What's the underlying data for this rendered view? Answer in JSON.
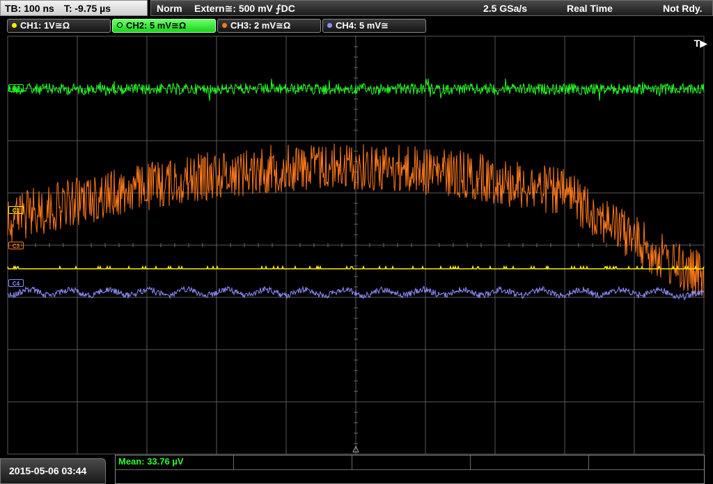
{
  "timebase": {
    "tb": "TB: 100 ns",
    "t": "T: -9.75 µs"
  },
  "trigger": {
    "mode": "Norm",
    "source": "Extern≅: 500 mV ⨍DC",
    "sample_rate": "2.5 GSa/s",
    "acq_mode": "Real Time",
    "status": "Not Rdy."
  },
  "channels": [
    {
      "id": "ch1",
      "label": "CH1: 1V≅Ω",
      "color": "#ffee00",
      "active": false
    },
    {
      "id": "ch2",
      "label": "CH2: 5 mV≅Ω",
      "color": "#22ff22",
      "active": true
    },
    {
      "id": "ch3",
      "label": "CH3: 2 mV≅Ω",
      "color": "#ff7a1a",
      "active": false
    },
    {
      "id": "ch4",
      "label": "CH4: 5 mV≅",
      "color": "#8f8fff",
      "active": false
    }
  ],
  "trace_markers": [
    {
      "id": "ch2",
      "text": "C2"
    },
    {
      "id": "ch1",
      "text": "C1"
    },
    {
      "id": "ch3",
      "text": "C3"
    },
    {
      "id": "ch4",
      "text": "C4"
    }
  ],
  "trigger_marker": "T▶",
  "timestamp": "2015-05-06 03:44",
  "measurement": {
    "label": "Mean:",
    "value": "33.76 µV"
  },
  "colors": {
    "grid": "#5a5a5a",
    "measure_text": "#2aff2a"
  }
}
